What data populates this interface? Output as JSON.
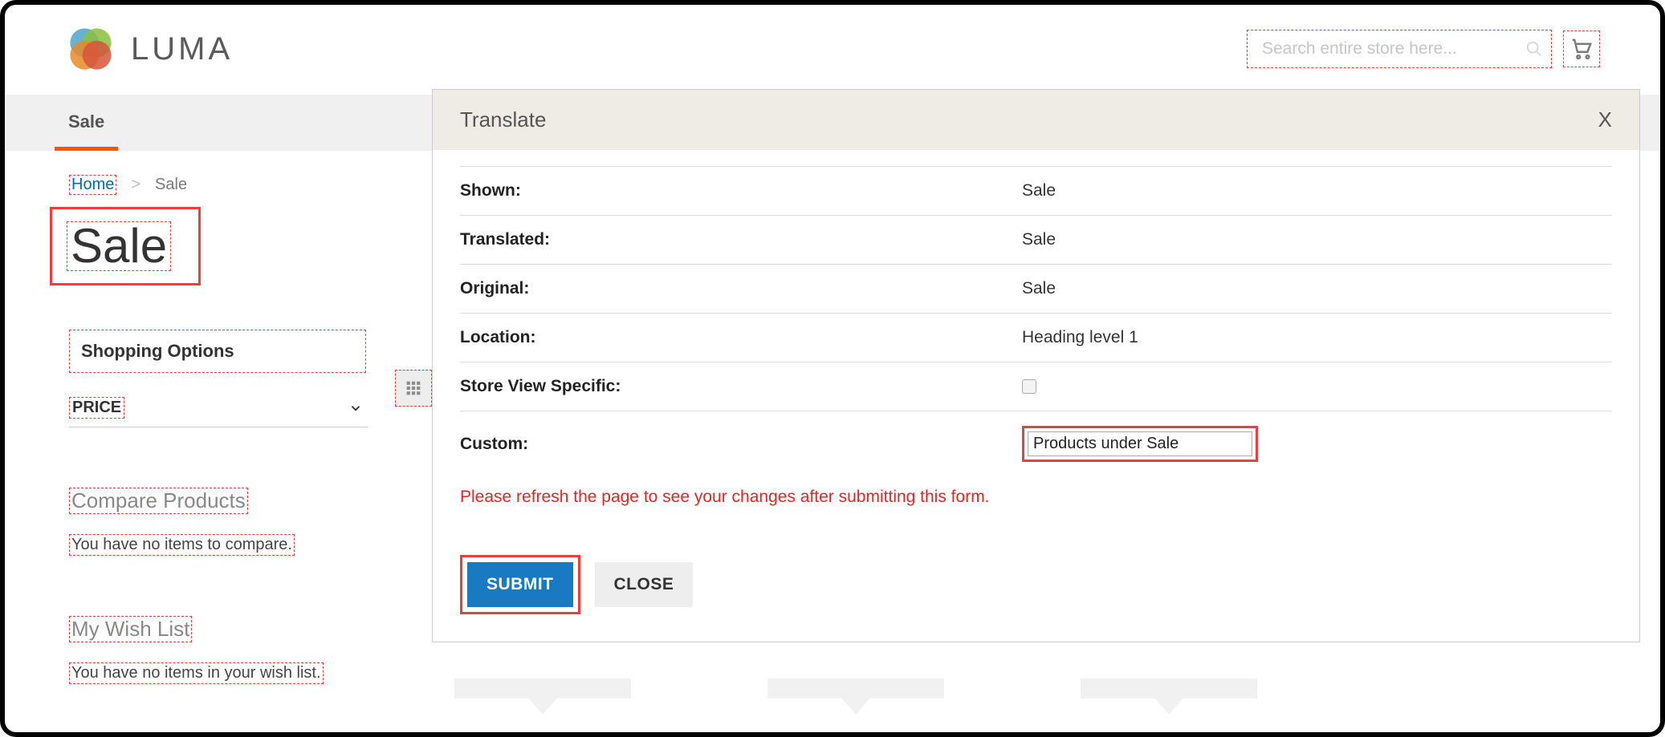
{
  "header": {
    "logo_text": "LUMA",
    "search_placeholder": "Search entire store here..."
  },
  "nav": {
    "active_tab": "Sale"
  },
  "breadcrumb": {
    "home": "Home",
    "sep": ">",
    "current": "Sale"
  },
  "title": "Sale",
  "sidebar": {
    "shopping_options": "Shopping Options",
    "price_label": "PRICE",
    "compare_heading": "Compare Products",
    "compare_empty": "You have no items to compare.",
    "wishlist_heading": "My Wish List",
    "wishlist_empty": "You have no items in your wish list."
  },
  "translate": {
    "panel_title": "Translate",
    "close_glyph": "X",
    "rows": {
      "shown_label": "Shown:",
      "shown_value": "Sale",
      "translated_label": "Translated:",
      "translated_value": "Sale",
      "original_label": "Original:",
      "original_value": "Sale",
      "location_label": "Location:",
      "location_value": "Heading level 1",
      "storeview_label": "Store View Specific:",
      "custom_label": "Custom:",
      "custom_value": "Products under Sale"
    },
    "refresh_msg": "Please refresh the page to see your changes after submitting this form.",
    "submit_label": "SUBMIT",
    "close_label": "CLOSE"
  }
}
